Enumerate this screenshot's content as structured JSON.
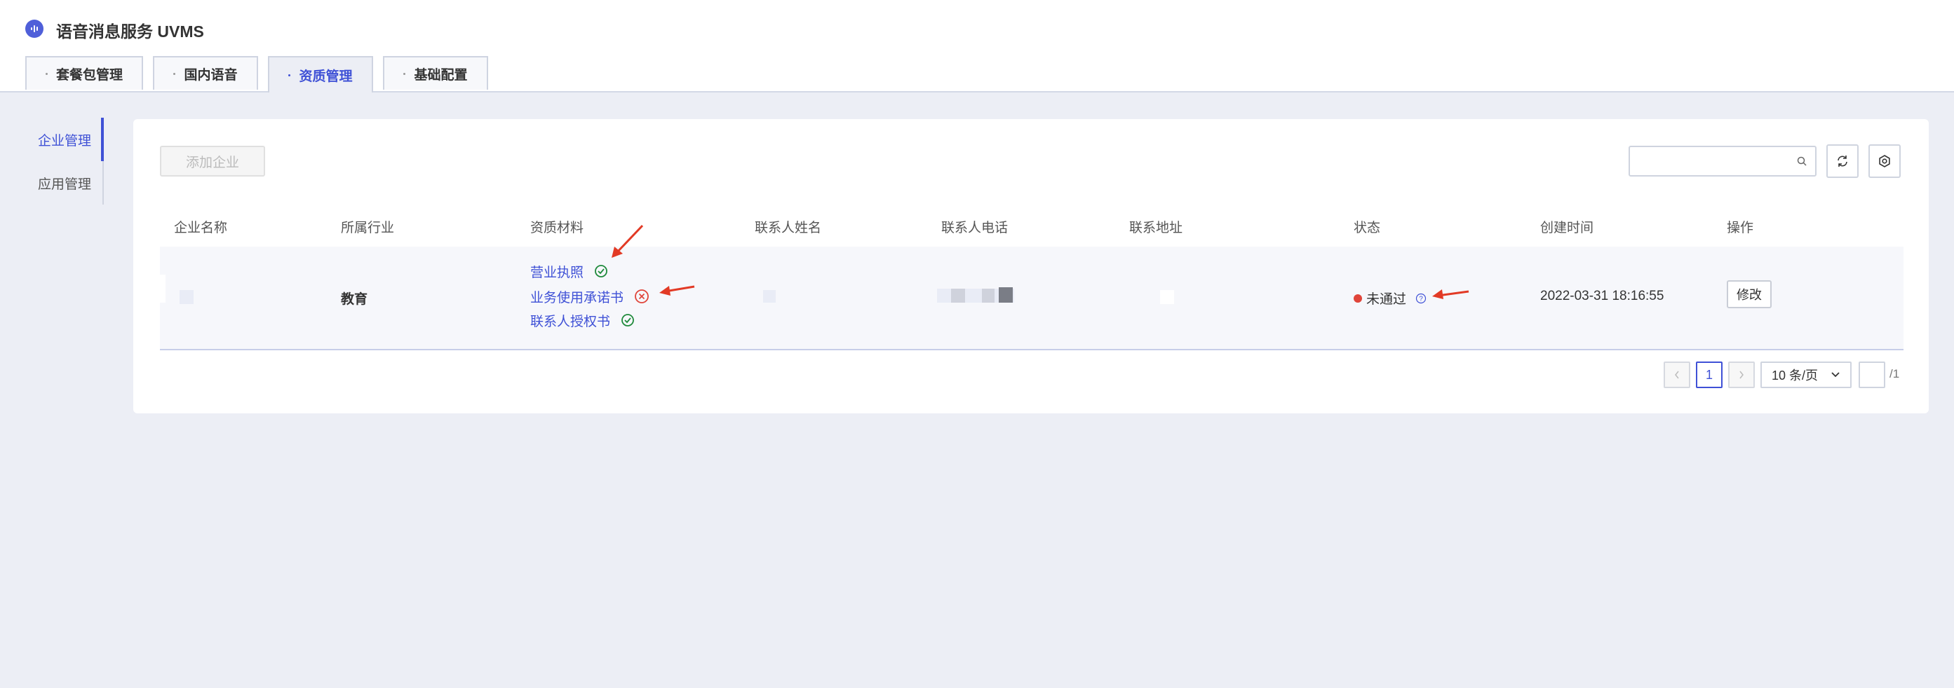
{
  "app": {
    "title": "语音消息服务 UVMS"
  },
  "tabs": [
    {
      "label": "套餐包管理"
    },
    {
      "label": "国内语音"
    },
    {
      "label": "资质管理"
    },
    {
      "label": "基础配置"
    }
  ],
  "sidebar": {
    "items": [
      {
        "label": "企业管理"
      },
      {
        "label": "应用管理"
      }
    ]
  },
  "toolbar": {
    "add_label": "添加企业",
    "search_placeholder": ""
  },
  "table": {
    "headers": [
      "企业名称",
      "所属行业",
      "资质材料",
      "联系人姓名",
      "联系人电话",
      "联系地址",
      "状态",
      "创建时间",
      "操作"
    ],
    "rows": [
      {
        "industry": "教育",
        "materials": [
          {
            "label": "营业执照",
            "state": "approved"
          },
          {
            "label": "业务使用承诺书",
            "state": "rejected"
          },
          {
            "label": "联系人授权书",
            "state": "approved"
          }
        ],
        "status": "未通过",
        "created": "2022-03-31 18:16:55",
        "action": "修改"
      }
    ]
  },
  "pagination": {
    "current": "1",
    "page_size": "10 条/页",
    "total": "/1"
  },
  "colors": {
    "accent": "#3f51d6",
    "ok": "#1f8a3b",
    "error": "#e0453a",
    "annotation": "#e23a25"
  }
}
